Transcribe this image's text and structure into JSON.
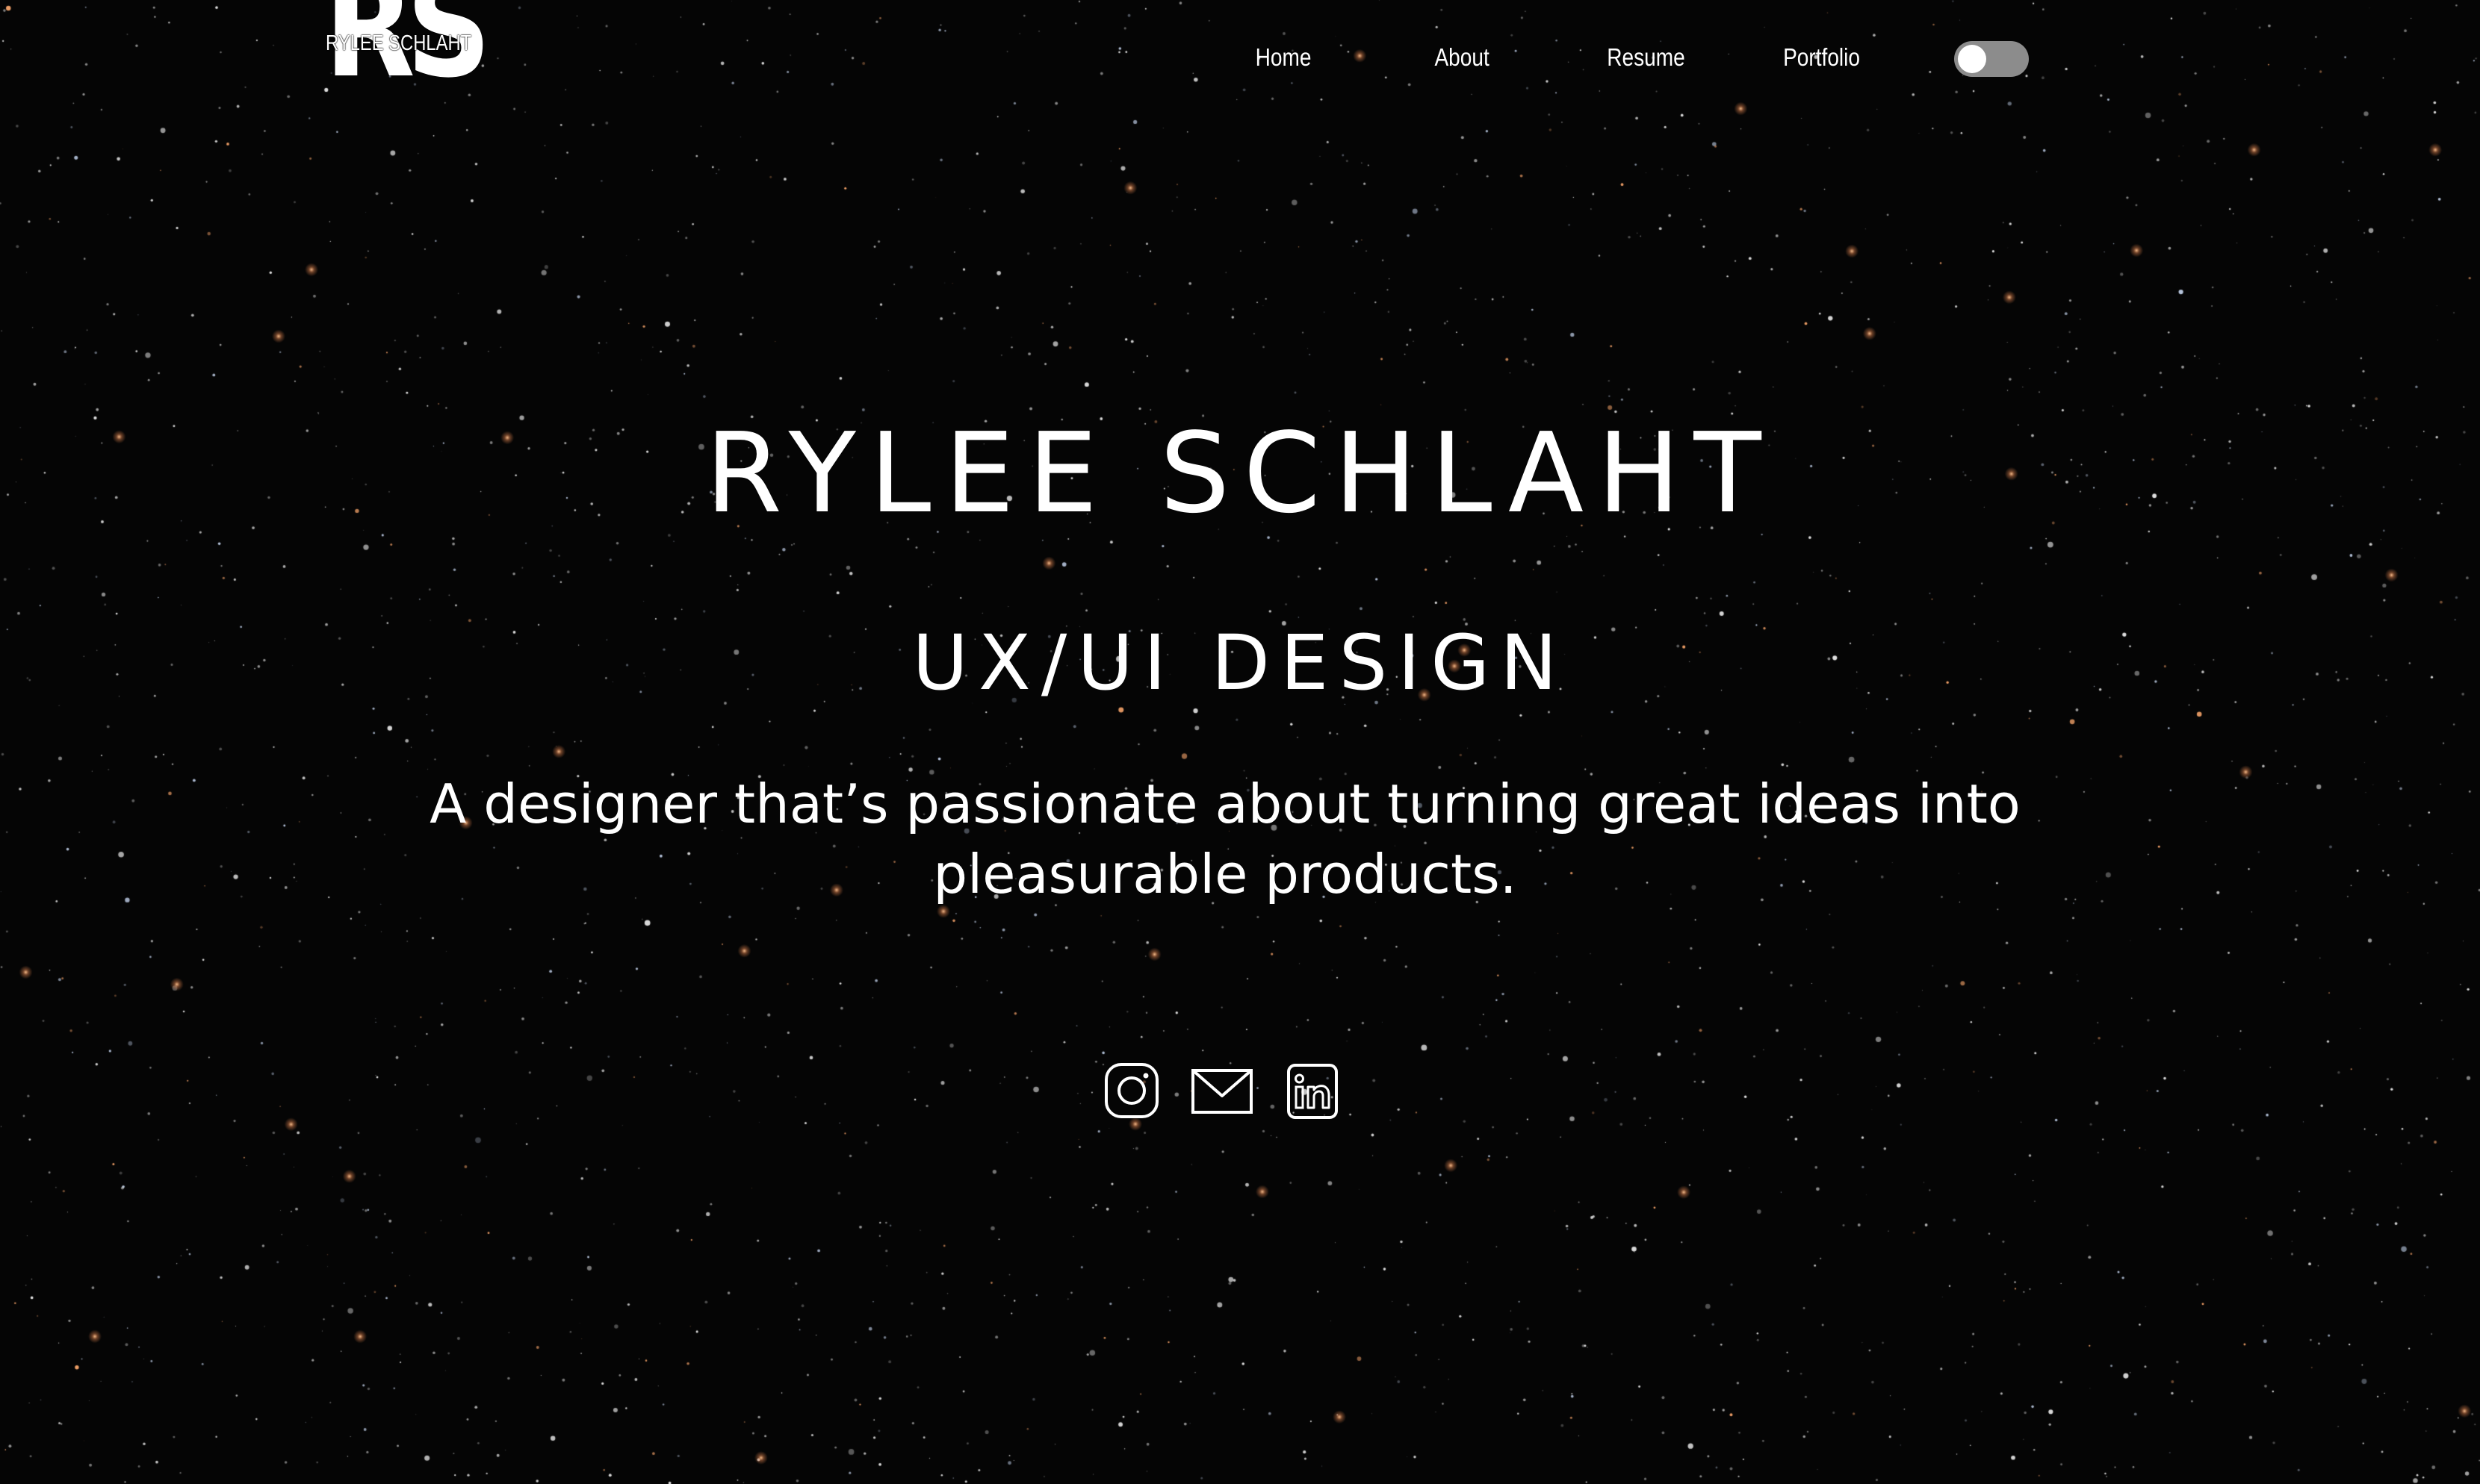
{
  "page": {
    "background_color": "#050505",
    "text_color": "#ffffff"
  },
  "header": {
    "logo": {
      "letters": "RS",
      "name": "RYLEE SCHLAHT"
    },
    "nav": {
      "items": [
        {
          "label": "Home"
        },
        {
          "label": "About"
        },
        {
          "label": "Resume"
        },
        {
          "label": "Portfolio"
        }
      ]
    },
    "theme_toggle": {
      "state": "off",
      "track_color": "#8c8c8c",
      "knob_color": "#ffffff"
    }
  },
  "hero": {
    "name": "RYLEE SCHLAHT",
    "role": "UX/UI DESIGN",
    "tagline": "A designer that’s passionate about turning great ideas into pleasurable products."
  },
  "socials": [
    {
      "icon": "instagram-icon"
    },
    {
      "icon": "mail-icon"
    },
    {
      "icon": "linkedin-icon"
    }
  ]
}
